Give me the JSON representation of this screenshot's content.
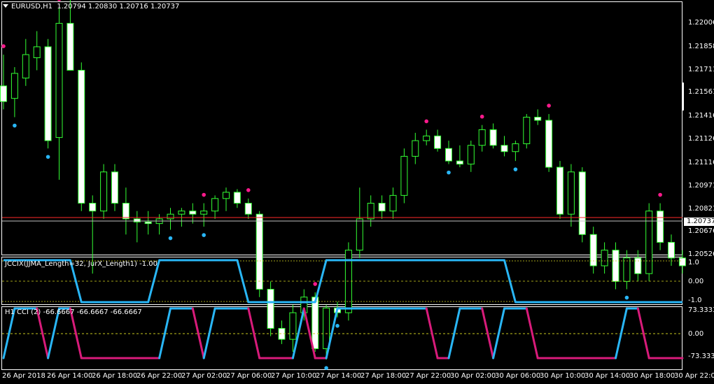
{
  "header": {
    "symbol": "EURUSD,H1",
    "quote": "1.20794 1.20830 1.20716 1.20737"
  },
  "price_axis": {
    "ticks": [
      "1.22006",
      "1.21858",
      "1.21711",
      "1.21561",
      "1.21416",
      "1.21126",
      "1.21116",
      "1.20971",
      "1.20821",
      "1.20676",
      "1.20526"
    ],
    "current_price": "1.20737"
  },
  "indicator1": {
    "label": "JCCIX(JJMA_Length=32, JurX_Length1) -1.00",
    "ticks": [
      "1.0",
      "0.00",
      "-1.0"
    ]
  },
  "indicator2": {
    "label": "H1 CCI (2) -66.6667 -66.6667 -66.6667",
    "ticks": [
      "73.3333",
      "0.00",
      "-73.3333"
    ]
  },
  "time_axis": [
    "26 Apr 2018",
    "26 Apr 14:00",
    "26 Apr 18:00",
    "26 Apr 22:00",
    "27 Apr 02:00",
    "27 Apr 06:00",
    "27 Apr 10:00",
    "27 Apr 14:00",
    "27 Apr 18:00",
    "27 Apr 22:00",
    "30 Apr 02:00",
    "30 Apr 06:00",
    "30 Apr 10:00",
    "30 Apr 14:00",
    "30 Apr 18:00",
    "30 Apr 22:00"
  ],
  "colors": {
    "background": "#000000",
    "bull_candle": "#000000",
    "bear_candle": "#ffffff",
    "wick": "#33ff33",
    "grid_dash": "#c8c81e",
    "jccix_line": "#29b6f6",
    "cci_up": "#29b6f6",
    "cci_down": "#d81b7a",
    "dot_high": "#ff1a8c",
    "dot_low": "#29b6f6",
    "price_line_red": "#ff2a2a",
    "price_line_white": "#c0c0c0"
  },
  "chart_data": {
    "type": "candlestick",
    "symbol": "EURUSD",
    "timeframe": "H1",
    "ohlc": [
      [
        1.216,
        1.218,
        1.2145,
        1.215
      ],
      [
        1.2152,
        1.2172,
        1.214,
        1.2168
      ],
      [
        1.2165,
        1.219,
        1.216,
        1.218
      ],
      [
        1.2178,
        1.2195,
        1.217,
        1.2185
      ],
      [
        1.2185,
        1.219,
        1.212,
        1.2125
      ],
      [
        1.2127,
        1.221,
        1.21,
        1.22
      ],
      [
        1.22,
        1.222,
        1.217,
        1.217
      ],
      [
        1.217,
        1.2175,
        1.208,
        1.2085
      ],
      [
        1.2085,
        1.209,
        1.204,
        1.208
      ],
      [
        1.208,
        1.211,
        1.2075,
        1.2105
      ],
      [
        1.2105,
        1.211,
        1.208,
        1.2085
      ],
      [
        1.2085,
        1.2095,
        1.2065,
        1.2075
      ],
      [
        1.2075,
        1.208,
        1.206,
        1.2073
      ],
      [
        1.2073,
        1.208,
        1.2065,
        1.2072
      ],
      [
        1.2072,
        1.2078,
        1.2065,
        1.2075
      ],
      [
        1.2075,
        1.2082,
        1.2068,
        1.2078
      ],
      [
        1.2078,
        1.2082,
        1.207,
        1.208
      ],
      [
        1.208,
        1.2085,
        1.2072,
        1.2078
      ],
      [
        1.2078,
        1.2085,
        1.207,
        1.208
      ],
      [
        1.208,
        1.209,
        1.2075,
        1.2088
      ],
      [
        1.2088,
        1.2095,
        1.208,
        1.2092
      ],
      [
        1.2092,
        1.2094,
        1.2082,
        1.2085
      ],
      [
        1.2085,
        1.2088,
        1.2075,
        1.2078
      ],
      [
        1.2078,
        1.208,
        1.2025,
        1.203
      ],
      [
        1.203,
        1.2035,
        1.2,
        1.2005
      ],
      [
        1.2005,
        1.201,
        1.1995,
        1.1998
      ],
      [
        1.1998,
        1.202,
        1.199,
        1.2015
      ],
      [
        1.2015,
        1.203,
        1.201,
        1.2025
      ],
      [
        1.2025,
        1.2028,
        1.199,
        1.1992
      ],
      [
        1.1992,
        1.202,
        1.1985,
        1.2018
      ],
      [
        1.2018,
        1.2022,
        1.2012,
        1.2015
      ],
      [
        1.2015,
        1.206,
        1.201,
        1.2055
      ],
      [
        1.2055,
        1.2095,
        1.205,
        1.2075
      ],
      [
        1.2075,
        1.209,
        1.207,
        1.2085
      ],
      [
        1.2085,
        1.209,
        1.2075,
        1.208
      ],
      [
        1.208,
        1.2095,
        1.2075,
        1.209
      ],
      [
        1.209,
        1.212,
        1.2085,
        1.2115
      ],
      [
        1.2115,
        1.213,
        1.211,
        1.2125
      ],
      [
        1.2125,
        1.2132,
        1.2122,
        1.2128
      ],
      [
        1.2128,
        1.2132,
        1.2118,
        1.212
      ],
      [
        1.212,
        1.2125,
        1.211,
        1.2112
      ],
      [
        1.2112,
        1.2122,
        1.2108,
        1.211
      ],
      [
        1.211,
        1.2125,
        1.2105,
        1.2122
      ],
      [
        1.2122,
        1.2135,
        1.2118,
        1.2132
      ],
      [
        1.2132,
        1.2136,
        1.212,
        1.2122
      ],
      [
        1.2122,
        1.2128,
        1.2115,
        1.2118
      ],
      [
        1.2118,
        1.2125,
        1.2112,
        1.2123
      ],
      [
        1.2123,
        1.2142,
        1.212,
        1.214
      ],
      [
        1.214,
        1.2145,
        1.2135,
        1.2138
      ],
      [
        1.2138,
        1.2142,
        1.2105,
        1.2108
      ],
      [
        1.2108,
        1.2112,
        1.2075,
        1.2078
      ],
      [
        1.2078,
        1.211,
        1.207,
        1.2105
      ],
      [
        1.2105,
        1.2108,
        1.206,
        1.2065
      ],
      [
        1.2065,
        1.207,
        1.204,
        1.2045
      ],
      [
        1.2045,
        1.206,
        1.204,
        1.2055
      ],
      [
        1.2055,
        1.206,
        1.203,
        1.2035
      ],
      [
        1.2035,
        1.2055,
        1.203,
        1.205
      ],
      [
        1.205,
        1.2055,
        1.2035,
        1.204
      ],
      [
        1.204,
        1.2085,
        1.2035,
        1.208
      ],
      [
        1.208,
        1.2085,
        1.2055,
        1.206
      ],
      [
        1.206,
        1.2065,
        1.2045,
        1.205
      ],
      [
        1.205,
        1.2055,
        1.204,
        1.2045
      ]
    ],
    "markers_high": [
      0,
      5,
      6,
      18,
      22,
      28,
      38,
      43,
      49,
      59
    ],
    "markers_low": [
      1,
      4,
      15,
      18,
      29,
      30,
      40,
      46,
      56
    ],
    "jccix_levels": [
      1,
      1,
      1,
      1,
      1,
      1,
      1,
      -1,
      -1,
      -1,
      -1,
      -1,
      -1,
      -1,
      1,
      1,
      1,
      1,
      1,
      1,
      1,
      1,
      -1,
      -1,
      -1,
      -1,
      -1,
      -1,
      -1,
      1,
      1,
      1,
      1,
      1,
      1,
      1,
      1,
      1,
      1,
      1,
      1,
      1,
      1,
      1,
      1,
      1,
      -1,
      -1,
      -1,
      -1,
      -1,
      -1,
      -1,
      -1,
      -1,
      -1,
      -1,
      -1,
      -1,
      -1,
      -1,
      -1
    ],
    "cci_levels": [
      -1,
      1,
      1,
      1,
      -1,
      1,
      1,
      -1,
      -1,
      -1,
      -1,
      -1,
      -1,
      -1,
      -1,
      1,
      1,
      1,
      -1,
      1,
      1,
      1,
      1,
      -1,
      -1,
      -1,
      -1,
      1,
      -1,
      -1,
      1,
      1,
      1,
      1,
      1,
      1,
      1,
      1,
      1,
      -1,
      -1,
      1,
      1,
      1,
      -1,
      1,
      1,
      1,
      -1,
      -1,
      -1,
      -1,
      -1,
      -1,
      -1,
      -1,
      1,
      1,
      -1,
      -1,
      -1,
      -1
    ]
  }
}
